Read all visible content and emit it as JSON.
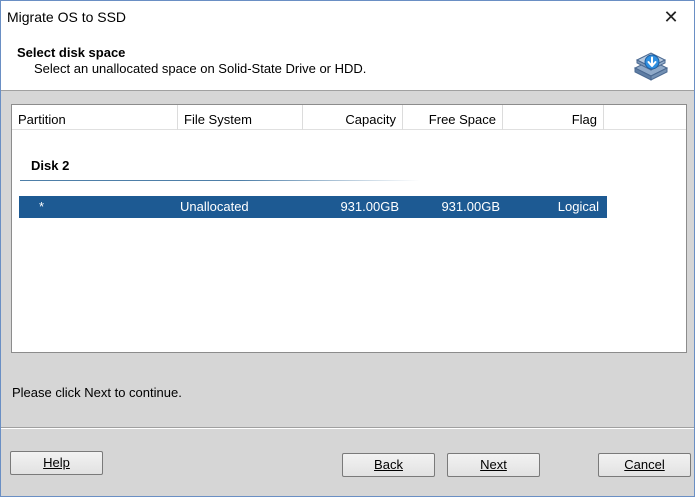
{
  "window": {
    "title": "Migrate OS to SSD",
    "close_glyph": "✕"
  },
  "header": {
    "title": "Select disk space",
    "subtitle": "Select an unallocated space on Solid-State Drive or HDD.",
    "icon": "disk-migrate-icon"
  },
  "list": {
    "columns": [
      "Partition",
      "File System",
      "Capacity",
      "Free Space",
      "Flag"
    ],
    "group": "Disk 2",
    "rows": [
      {
        "partition": "*",
        "file_system": "Unallocated",
        "capacity": "931.00GB",
        "free_space": "931.00GB",
        "flag": "Logical",
        "selected": true
      }
    ]
  },
  "status": "Please click Next to continue.",
  "buttons": {
    "help": "Help",
    "back": "Back",
    "next": "Next",
    "cancel": "Cancel"
  },
  "colors": {
    "selection": "#1d5a93",
    "accent_line": "#4e7fa8"
  }
}
